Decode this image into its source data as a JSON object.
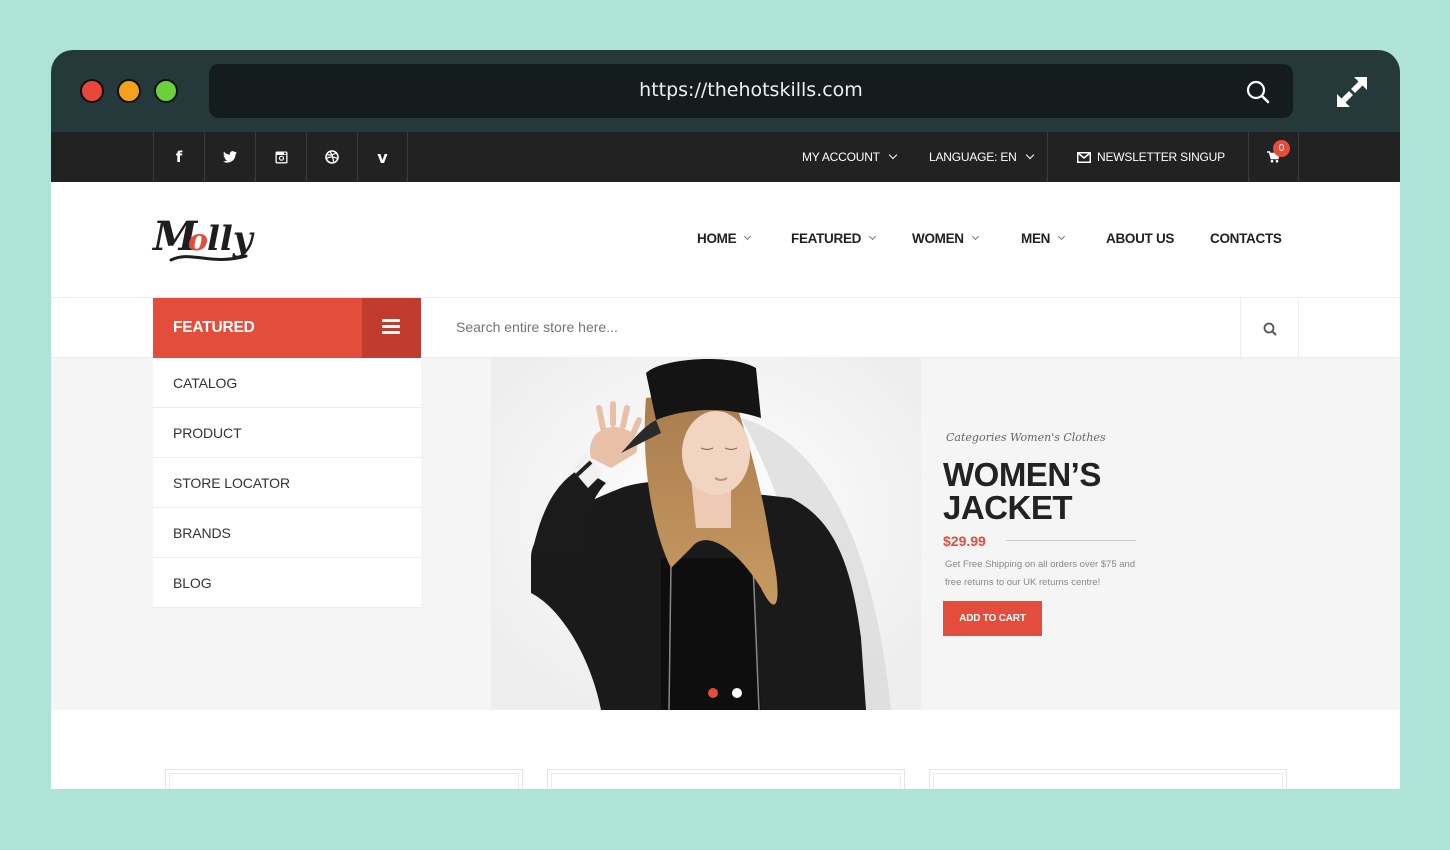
{
  "browser": {
    "url": "https://thehotskills.com",
    "controls": [
      "close",
      "minimize",
      "maximize"
    ]
  },
  "topbar": {
    "social": [
      {
        "icon": "facebook-icon",
        "glyph": "f"
      },
      {
        "icon": "twitter-icon",
        "glyph": "🐦"
      },
      {
        "icon": "instagram-icon",
        "glyph": "◙"
      },
      {
        "icon": "dribbble-icon",
        "glyph": "⊛"
      },
      {
        "icon": "vimeo-icon",
        "glyph": "v"
      }
    ],
    "my_account": "MY ACCOUNT",
    "language": "LANGUAGE: EN",
    "newsletter": "NEWSLETTER SINGUP",
    "cart_count": "0"
  },
  "header": {
    "logo_text": "Molly",
    "nav": [
      {
        "label": "HOME",
        "dropdown": true
      },
      {
        "label": "FEATURED",
        "dropdown": true
      },
      {
        "label": "WOMEN",
        "dropdown": true
      },
      {
        "label": "MEN",
        "dropdown": true
      },
      {
        "label": "ABOUT US",
        "dropdown": false
      },
      {
        "label": "CONTACTS",
        "dropdown": false
      }
    ]
  },
  "search": {
    "category_label": "FEATURED",
    "placeholder": "Search entire store here...",
    "value": ""
  },
  "side_menu": {
    "items": [
      "CATALOG",
      "PRODUCT",
      "STORE LOCATOR",
      "BRANDS",
      "BLOG"
    ]
  },
  "hero": {
    "category": "Categories Women's Clothes",
    "title_line1": "WOMEN’S",
    "title_line2": "JACKET",
    "price": "$29.99",
    "description": "Get Free Shipping on all orders over $75 and free returns to our UK returns centre!",
    "cta": "ADD TO CART",
    "slides": 2,
    "active_slide": 1
  },
  "colors": {
    "accent": "#e44c3c",
    "accent_dark": "#c23b2f",
    "topbar": "#222222",
    "chrome": "#25393a",
    "page_bg": "#aee4d8"
  }
}
